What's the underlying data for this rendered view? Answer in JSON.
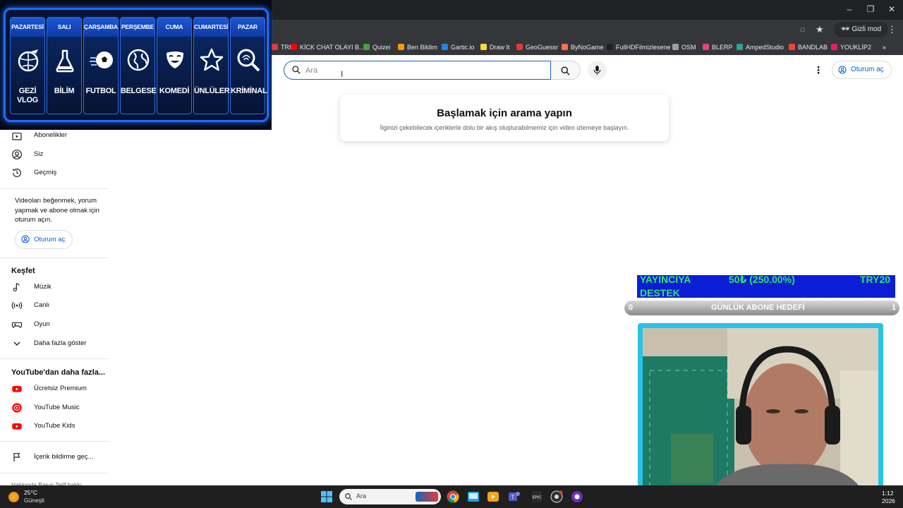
{
  "browser": {
    "incognito_label": "Gizli mod",
    "bookmarks": [
      {
        "label": "TRIX",
        "color": "#e53935"
      },
      {
        "label": "KİCK CHAT OLAYI B...",
        "color": "#ff0000"
      },
      {
        "label": "Quizei",
        "color": "#43a047"
      },
      {
        "label": "Ben Bildim",
        "color": "#ff9800"
      },
      {
        "label": "Gartic.io",
        "color": "#1e88e5"
      },
      {
        "label": "Draw It",
        "color": "#fdd835"
      },
      {
        "label": "GeoGuessr",
        "color": "#e53935"
      },
      {
        "label": "ByNoGame",
        "color": "#ff7043"
      },
      {
        "label": "FullHDFilmizlesene",
        "color": "#212121"
      },
      {
        "label": "OSM",
        "color": "#9e9e9e"
      },
      {
        "label": "BLERP",
        "color": "#ec407a"
      },
      {
        "label": "AmpedStudio",
        "color": "#26a69a"
      },
      {
        "label": "BANDLAB",
        "color": "#f44336"
      },
      {
        "label": "YOUKLİP2",
        "color": "#e91e63"
      }
    ]
  },
  "youtube": {
    "search": {
      "placeholder": "Ara"
    },
    "signin_label": "Oturum aç",
    "empty_state": {
      "title": "Başlamak için arama yapın",
      "subtitle": "İlginizi çekebilecek içeriklerle dolu bir akış oluşturabilmemiz için video izlemeye başlayın."
    },
    "sidebar": {
      "top_items": [
        {
          "label": "Abonelikler",
          "icon": "subscriptions-icon"
        },
        {
          "label": "Siz",
          "icon": "account-icon"
        },
        {
          "label": "Geçmiş",
          "icon": "history-icon"
        }
      ],
      "signin_note": "Videoları beğenmek, yorum yapmak ve abone olmak için oturum açın.",
      "signin_label": "Oturum aç",
      "explore_title": "Keşfet",
      "explore_items": [
        {
          "label": "Müzik",
          "icon": "music-icon"
        },
        {
          "label": "Canlı",
          "icon": "live-icon"
        },
        {
          "label": "Oyun",
          "icon": "gaming-icon"
        },
        {
          "label": "Daha fazla göster",
          "icon": "chevron-down-icon"
        }
      ],
      "more_title": "YouTube'dan daha fazla...",
      "more_items": [
        {
          "label": "Ücretsiz Premium",
          "icon": "youtube-premium-icon"
        },
        {
          "label": "YouTube Music",
          "icon": "youtube-music-icon"
        },
        {
          "label": "YouTube Kids",
          "icon": "youtube-kids-icon"
        }
      ],
      "report_label": "İçerik bildirme geç...",
      "footer": "Hakkında Basın Telif hakkı"
    }
  },
  "schedule": {
    "days": [
      {
        "day": "PAZARTESİ",
        "category": "GEZİ VLOG",
        "icon": "globe-plane-icon"
      },
      {
        "day": "SALI",
        "category": "BİLİM",
        "icon": "flask-icon"
      },
      {
        "day": "ÇARŞAMBA",
        "category": "FUTBOL",
        "icon": "soccer-ball-icon"
      },
      {
        "day": "PERŞEMBE",
        "category": "BELGESEL",
        "icon": "globe-icon"
      },
      {
        "day": "CUMA",
        "category": "KOMEDİ",
        "icon": "comedy-mask-icon"
      },
      {
        "day": "CUMARTESİ",
        "category": "ÜNLÜLER",
        "icon": "star-icon"
      },
      {
        "day": "PAZAR",
        "category": "KRİMİNAL",
        "icon": "magnifier-fingerprint-icon"
      }
    ]
  },
  "stream": {
    "donation": {
      "text_left": "YAYINCIYA",
      "text_left2": "DESTEK",
      "amount": "50₺ (250.00%)",
      "currency": "TRY20"
    },
    "sub_goal": {
      "min": "0",
      "label": "GÜNLÜK ABONE HEDEFİ",
      "max": "1"
    }
  },
  "taskbar": {
    "temperature": "25°C",
    "weather": "Güneşli",
    "search_placeholder": "Ara",
    "time": "1:12",
    "date": "2026"
  }
}
